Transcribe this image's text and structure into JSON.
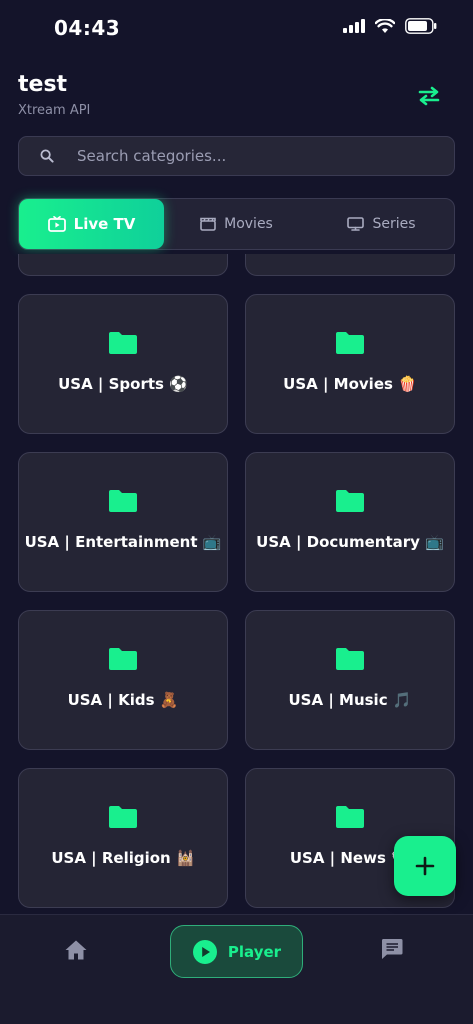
{
  "status_bar": {
    "time": "04:43"
  },
  "header": {
    "title": "test",
    "subtitle": "Xtream API",
    "switch_icon": "swap-arrows-icon"
  },
  "search": {
    "placeholder": "Search categories...",
    "value": ""
  },
  "tabs": [
    {
      "label": "Live TV",
      "icon": "tv-play-icon",
      "active": true
    },
    {
      "label": "Movies",
      "icon": "clapperboard-icon",
      "active": false
    },
    {
      "label": "Series",
      "icon": "monitor-icon",
      "active": false
    }
  ],
  "categories": [
    {
      "label": "",
      "icon": "folder-icon"
    },
    {
      "label": "",
      "icon": "folder-icon"
    },
    {
      "label": "USA | Sports ⚽",
      "icon": "folder-icon"
    },
    {
      "label": "USA | Movies 🍿",
      "icon": "folder-icon"
    },
    {
      "label": "USA | Entertainment 📺",
      "icon": "folder-icon"
    },
    {
      "label": "USA | Documentary 📺",
      "icon": "folder-icon"
    },
    {
      "label": "USA | Kids 🧸",
      "icon": "folder-icon"
    },
    {
      "label": "USA | Music 🎵",
      "icon": "folder-icon"
    },
    {
      "label": "USA | Religion 🕍",
      "icon": "folder-icon"
    },
    {
      "label": "USA | News 🗞",
      "icon": "folder-icon"
    }
  ],
  "fab": {
    "icon": "plus-icon"
  },
  "bottom_nav": {
    "home_icon": "home-icon",
    "player_label": "Player",
    "player_icon": "play-circle-icon",
    "chat_icon": "chat-icon"
  },
  "colors": {
    "accent": "#19ef8e",
    "background": "#14142a",
    "card": "#252535"
  }
}
